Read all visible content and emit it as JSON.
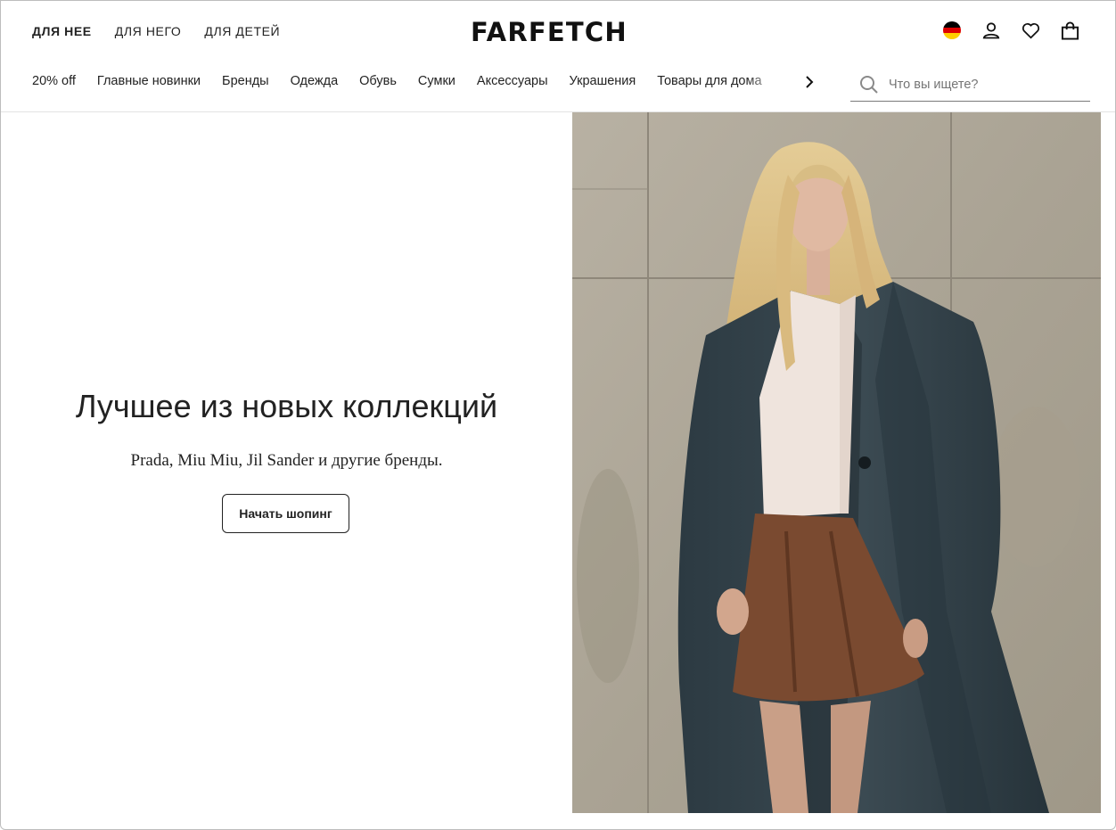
{
  "header": {
    "gender_tabs": [
      {
        "label": "ДЛЯ НЕЕ",
        "active": true
      },
      {
        "label": "ДЛЯ НЕГО",
        "active": false
      },
      {
        "label": "ДЛЯ ДЕТЕЙ",
        "active": false
      }
    ],
    "logo": "FARFETCH",
    "icons": [
      "germany-flag-icon",
      "account-icon",
      "wishlist-heart-icon",
      "shopping-bag-icon"
    ],
    "categories": [
      "20% off",
      "Главные новинки",
      "Бренды",
      "Одежда",
      "Обувь",
      "Сумки",
      "Аксессуары",
      "Украшения",
      "Товары для дома"
    ],
    "categories_next_icon": "chevron-right-icon",
    "search": {
      "placeholder": "Что вы ищете?",
      "value": "",
      "icon": "search-icon"
    }
  },
  "hero": {
    "title": "Лучшее из новых коллекций",
    "subtitle": "Prada, Miu Miu, Jil Sander и другие бренды.",
    "button_label": "Начать шопинг"
  },
  "colors": {
    "text": "#222222",
    "background": "#ffffff",
    "divider": "#e2e2e2",
    "flag": [
      "#000000",
      "#dd0000",
      "#ffce00"
    ]
  }
}
